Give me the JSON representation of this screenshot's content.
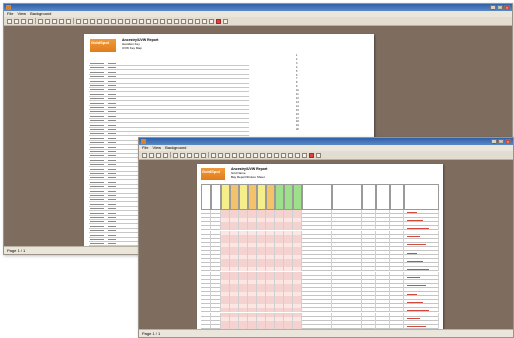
{
  "window_back": {
    "title": "",
    "menu": [
      "File",
      "View",
      "Background"
    ],
    "status": "Page 1 / 1",
    "report": {
      "logo_title": "GoldSpot",
      "logo_sub": "",
      "title_line1": "Ancestry/UVW Report",
      "title_line2": "Hamilton Key",
      "title_line3": "UVW Key Map",
      "legend_items": [
        "1",
        "2",
        "3",
        "4",
        "5",
        "6",
        "7",
        "8",
        "9",
        "10",
        "11",
        "12",
        "13",
        "14",
        "15",
        "16",
        "17",
        "18",
        "19",
        "20"
      ]
    }
  },
  "window_front": {
    "title": "",
    "menu": [
      "File",
      "View",
      "Background"
    ],
    "status": "Page 1 / 1",
    "report": {
      "logo_title": "GoldSpot",
      "logo_sub": "",
      "title_line1": "Ancestry/UVW Report",
      "title_line2": "Grid Name",
      "title_line3": "Bay Report/Fixture Sheet"
    }
  },
  "colors": {
    "workspace": "#7e6d5f",
    "chrome": "#eae6dc",
    "titlebar": "#2f5fa8",
    "logo_orange": "#e8842a",
    "header_yellow": "#f6ee8a",
    "header_orange": "#f5c26c",
    "header_green": "#9ee08a",
    "row_pink": "#f4d2cf",
    "highlight_red": "#e2413a"
  },
  "icons": [
    "app-icon",
    "minimize-icon",
    "maximize-icon",
    "close-icon",
    "toolbar-button-icon",
    "print-icon"
  ]
}
